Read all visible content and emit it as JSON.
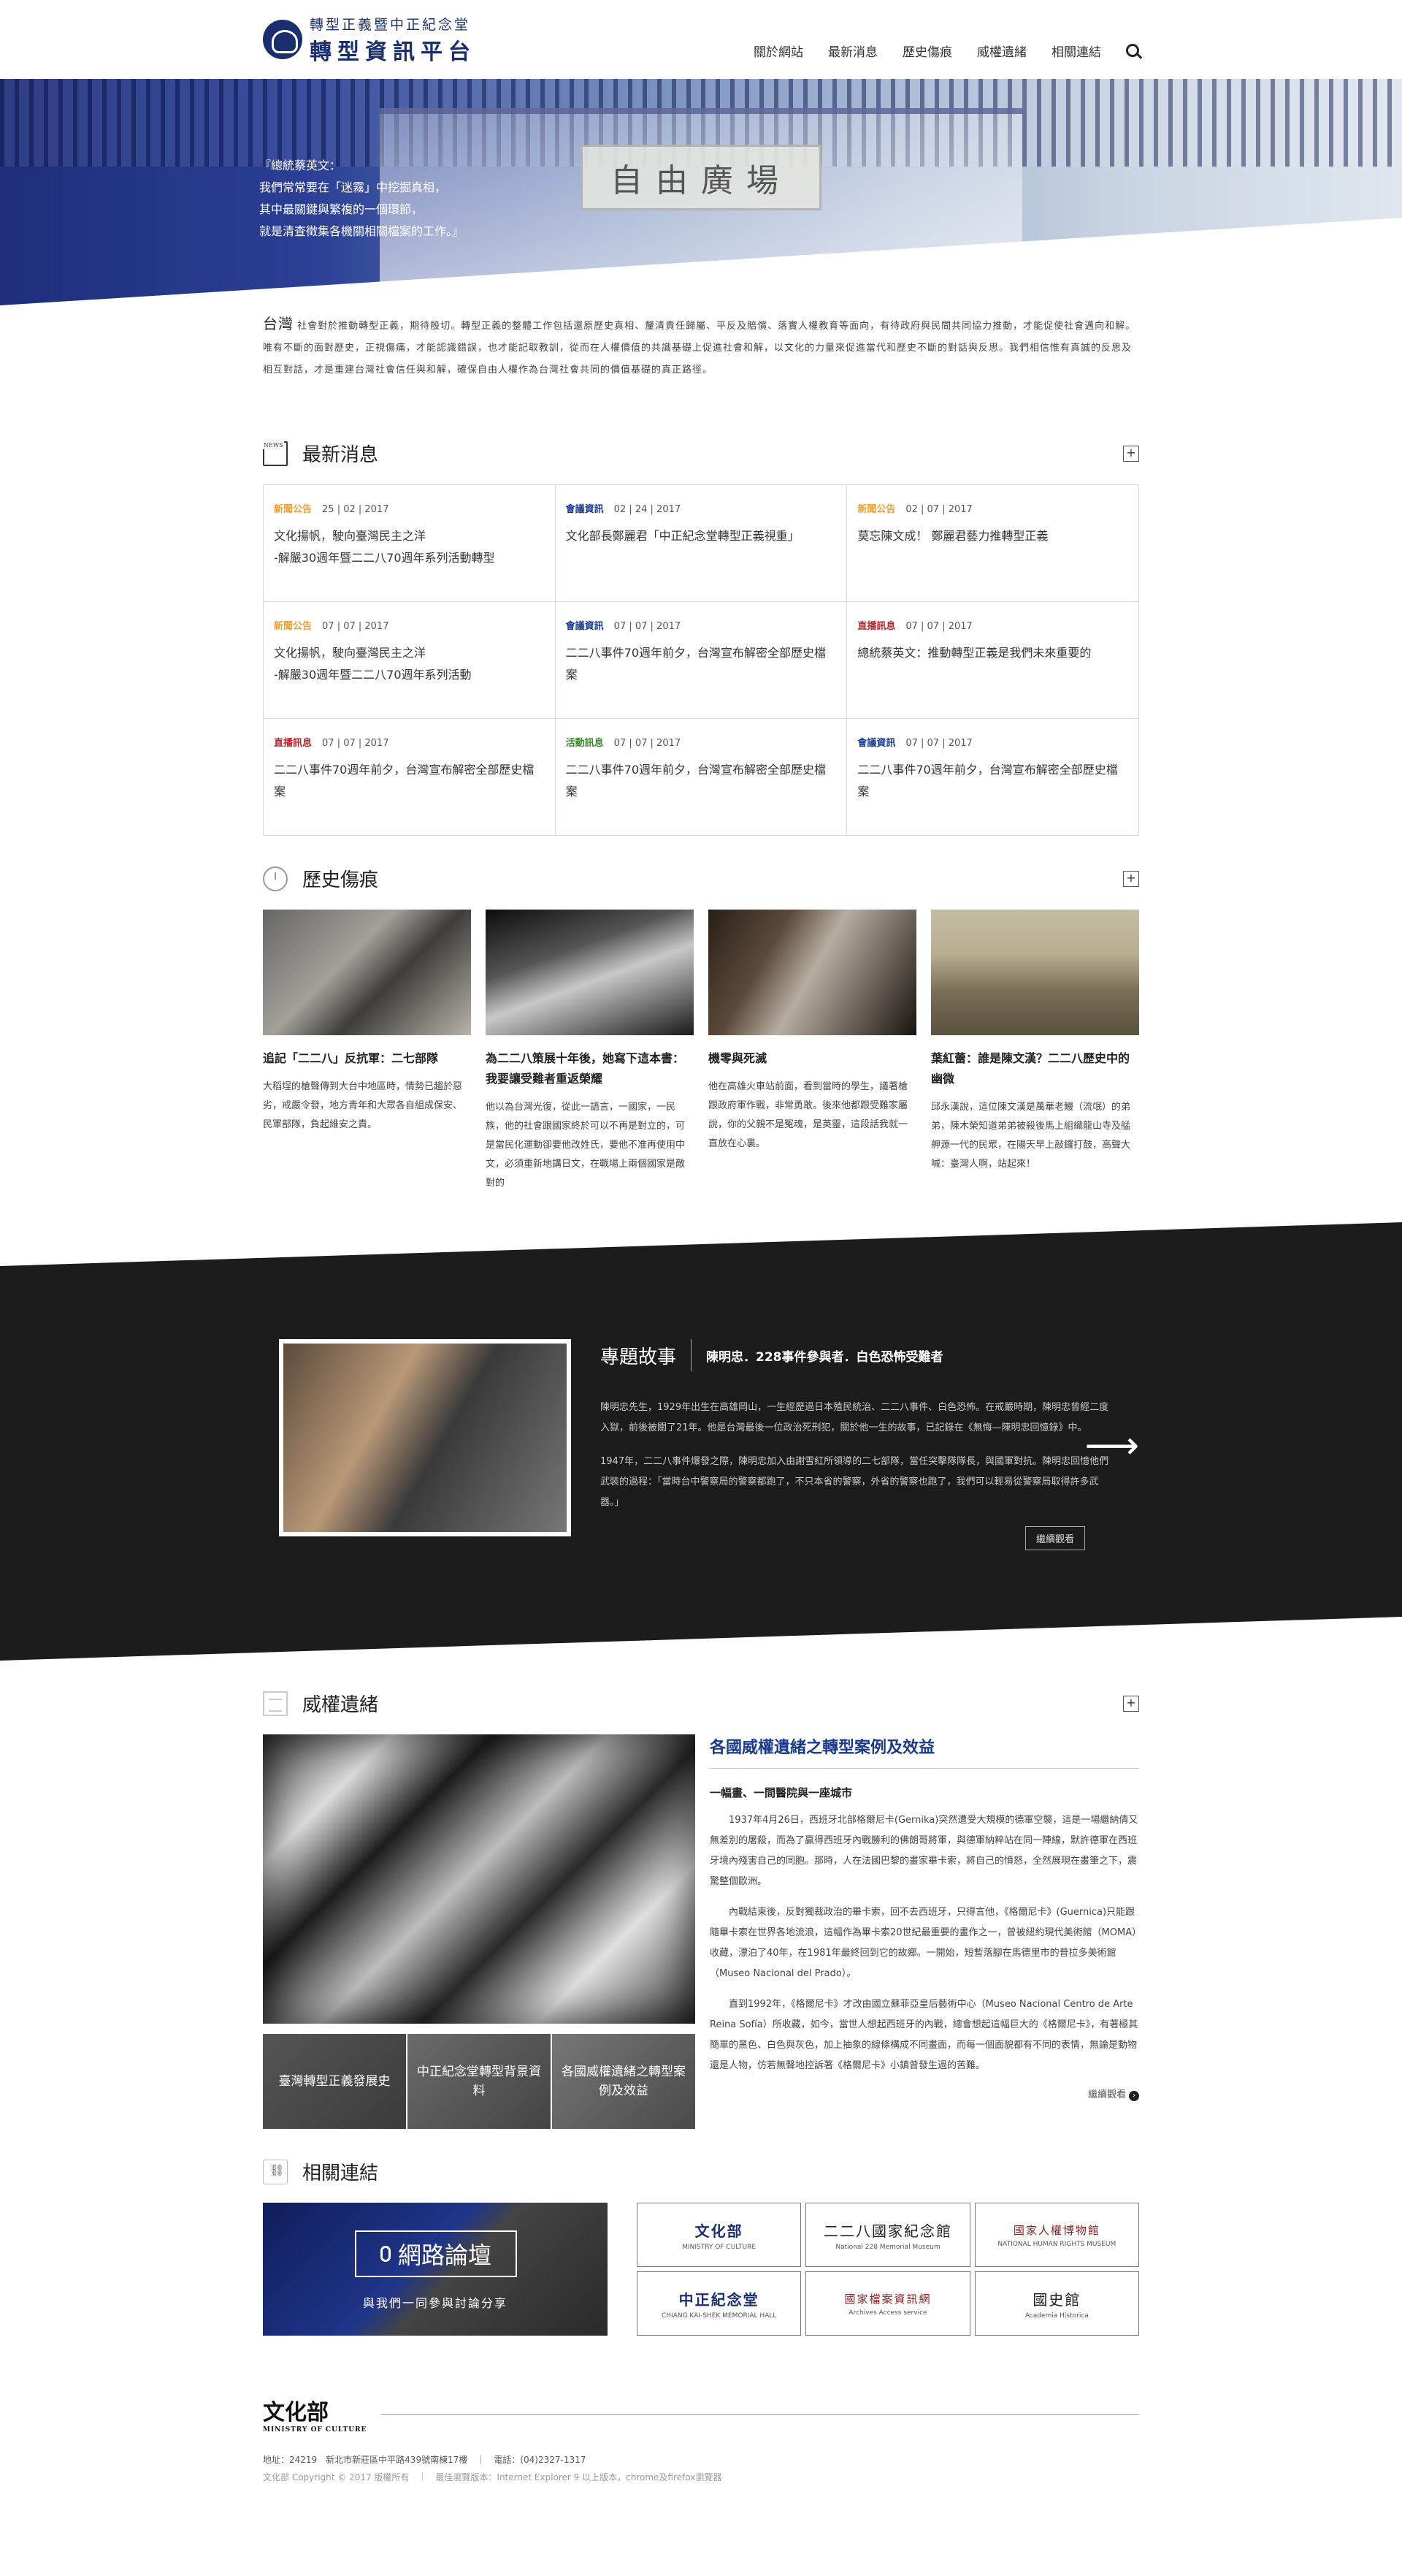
{
  "header": {
    "logo_sub": "轉型正義暨中正紀念堂",
    "logo_main": "轉型資訊平台",
    "nav": [
      "關於網站",
      "最新消息",
      "歷史傷痕",
      "威權遺緒",
      "相關連結"
    ]
  },
  "hero": {
    "plaque": "自由廣場",
    "quote_lines": [
      "『總統蔡英文：",
      "我們常常要在「迷霧」中挖掘真相，",
      "其中最關鍵與繁複的一個環節，",
      "就是清查徵集各機關相關檔案的工作。』"
    ]
  },
  "intro": {
    "lead": "台灣",
    "text": "社會對於推動轉型正義，期待殷切。轉型正義的整體工作包括還原歷史真相、釐清責任歸屬、平反及賠償、落實人權教育等面向，有待政府與民間共同協力推動，才能促使社會邁向和解。唯有不斷的面對歷史，正視傷痛，才能認識錯誤，也才能記取教訓，從而在人權價值的共識基礎上促進社會和解，以文化的力量來促進當代和歷史不斷的對話與反思。我們相信惟有真誠的反思及相互對話，才是重建台灣社會信任與和解，確保自由人權作為台灣社會共同的價值基礎的真正路徑。"
  },
  "news": {
    "title": "最新消息",
    "items": [
      {
        "cat": "新聞公告",
        "color": "#f0a030",
        "date": "25 | 02 | 2017",
        "title": "文化揚帆，駛向臺灣民主之洋\n-解嚴30週年暨二二八70週年系列活動轉型"
      },
      {
        "cat": "會議資訊",
        "color": "#1a3a8c",
        "date": "02 | 24 | 2017",
        "title": "文化部長鄭麗君「中正紀念堂轉型正義視重」"
      },
      {
        "cat": "新聞公告",
        "color": "#f0a030",
        "date": "02 | 07 | 2017",
        "title": "莫忘陳文成！ 鄭麗君藝力推轉型正義"
      },
      {
        "cat": "新聞公告",
        "color": "#f0a030",
        "date": "07 | 07 | 2017",
        "title": "文化揚帆，駛向臺灣民主之洋\n-解嚴30週年暨二二八70週年系列活動"
      },
      {
        "cat": "會議資訊",
        "color": "#1a3a8c",
        "date": "07 | 07 | 2017",
        "title": "二二八事件70週年前夕，台灣宣布解密全部歷史檔案"
      },
      {
        "cat": "直播訊息",
        "color": "#c0202a",
        "date": "07 | 07 | 2017",
        "title": "總統蔡英文：推動轉型正義是我們未來重要的"
      },
      {
        "cat": "直播訊息",
        "color": "#c0202a",
        "date": "07 | 07 | 2017",
        "title": "二二八事件70週年前夕，台灣宣布解密全部歷史檔案"
      },
      {
        "cat": "活動訊息",
        "color": "#3a8a2a",
        "date": "07 | 07 | 2017",
        "title": "二二八事件70週年前夕，台灣宣布解密全部歷史檔案"
      },
      {
        "cat": "會議資訊",
        "color": "#1a3a8c",
        "date": "07 | 07 | 2017",
        "title": "二二八事件70週年前夕，台灣宣布解密全部歷史檔案"
      }
    ]
  },
  "history": {
    "title": "歷史傷痕",
    "items": [
      {
        "title": "追記「二二八」反抗軍：二七部隊",
        "desc": "大稻埕的槍聲傳到大台中地區時，情勢已趨於惡劣，戒嚴令發，地方青年和大眾各自組成保安、民軍部隊，負起維安之責。"
      },
      {
        "title": "為二二八策展十年後，她寫下這本書：我要讓受難者重返榮耀",
        "desc": "他以為台灣光復，從此一語言，一國家，一民族，他的社會跟國家終於可以不再是對立的，可是當民化運動卻要他改姓氏，要他不准再使用中文，必須重新地講日文，在戰場上兩個國家是敵對的"
      },
      {
        "title": "機零與死滅",
        "desc": "他在高雄火車站前面，看到當時的學生，議著槍跟政府軍作戰，非常勇敢。後來他都跟受難家屬說，你的父親不是冤魂，是英靈，這段話我就一直放在心裏。"
      },
      {
        "title": "葉紅蕾：誰是陳文漢？二二八歷史中的幽微",
        "desc": "邱永漢說，這位陳文漢是萬華老鰻（流氓）的弟弟，陳木榮知道弟弟被殺後馬上組織龍山寺及艋舺源一代的民眾，在陽天早上敲鑼打鼓，高聲大喊：臺灣人啊，站起來！"
      }
    ]
  },
  "story": {
    "label": "專題故事",
    "sub": "陳明忠．228事件參與者．白色恐怖受難者",
    "p1": "陳明忠先生，1929年出生在高雄岡山，一生經歷過日本殖民統治、二二八事件、白色恐怖。在戒嚴時期，陳明忠曾經二度入獄，前後被關了21年。他是台灣最後一位政治死刑犯，關於他一生的故事，已記錄在《無悔—陳明忠回憶錄》中。",
    "p2": "1947年，二二八事件爆發之際，陳明忠加入由謝雪紅所領導的二七部隊，當任突擊隊隊長，與國軍對抗。陳明忠回憶他們武裝的過程：「當時台中警察局的警察都跑了，不只本省的警察，外省的警察也跑了，我們可以輕易從警察局取得許多武器。」",
    "more": "繼續觀看"
  },
  "authority": {
    "title": "威權遺緒",
    "headline": "各國威權遺緒之轉型案例及效益",
    "sub": "一幅畫、一間醫院與一座城市",
    "paragraphs": [
      "1937年4月26日，西班牙北部格爾尼卡(Gernika)突然遭受大規模的德軍空襲，這是一場繼納倩又無差別的屠殺，而為了贏得西班牙內戰勝利的佛朗哥將軍，與德軍納粹站在同一陣線，默許德軍在西班牙境內殘害自己的同胞。那時，人在法國巴黎的畫家畢卡索，將自己的憤怒，全然展現在畫筆之下，震驚整個歐洲。",
      "內戰結束後，反對獨裁政治的畢卡索，回不去西班牙，只得言他，《格爾尼卡》(Guernica)只能跟隨畢卡索在世界各地流浪，這幅作為畢卡索20世紀最重要的畫作之一，曾被紐約現代美術館（MOMA）收藏，漂泊了40年，在1981年最終回到它的故鄉。一開始，短暫落腳在馬德里市的普拉多美術館（Museo Nacional del Prado）。",
      "直到1992年，《格爾尼卡》才改由國立蘇菲亞皇后藝術中心（Museo Nacional Centro de Arte Reina Sofía）所收藏，如今，當世人想起西班牙的內戰，總會想起這幅巨大的《格爾尼卡》，有著極其簡單的黑色、白色與灰色，加上抽象的線條構成不同畫面，而每一個面貌都有不同的表情，無論是動物還是人物，仿若無聲地控訴著《格爾尼卡》小鎮曾發生過的苦難。"
    ],
    "thumbs": [
      "臺灣轉型正義發展史",
      "中正紀念堂轉型背景資料",
      "各國威權遺緒之轉型案例及效益"
    ],
    "more": "繼續觀看"
  },
  "links": {
    "title": "相關連結",
    "forum_title": "網路論壇",
    "forum_sub": "與我們一同參與討論分享",
    "partners": [
      {
        "name": "文化部",
        "en": "MINISTRY OF CULTURE",
        "style": "p-blue"
      },
      {
        "name": "二二八國家紀念館",
        "en": "National 228 Memorial Museum",
        "style": ""
      },
      {
        "name": "國家人權博物館",
        "en": "NATIONAL HUMAN RIGHTS MUSEUM",
        "style": "p-red"
      },
      {
        "name": "中正紀念堂",
        "en": "CHIANG KAI-SHEK MEMORIAL HALL",
        "style": "p-blue"
      },
      {
        "name": "國家檔案資訊網",
        "en": "Archives Access service",
        "style": "p-red"
      },
      {
        "name": "國史館",
        "en": "Academia Historica",
        "style": ""
      }
    ]
  },
  "footer": {
    "logo": "文化部",
    "logo_en": "MINISTRY OF CULTURE",
    "address": "地址：24219　新北市新莊區中平路439號南棟17樓　｜　電話：(04)2327-1317",
    "copyright": "文化部 Copyright © 2017 版權所有　｜　最佳瀏覽版本：Internet Explorer 9 以上版本，chrome及firefox瀏覽器"
  },
  "ui": {
    "more_symbol": "+",
    "next_arrow": "⟶"
  }
}
